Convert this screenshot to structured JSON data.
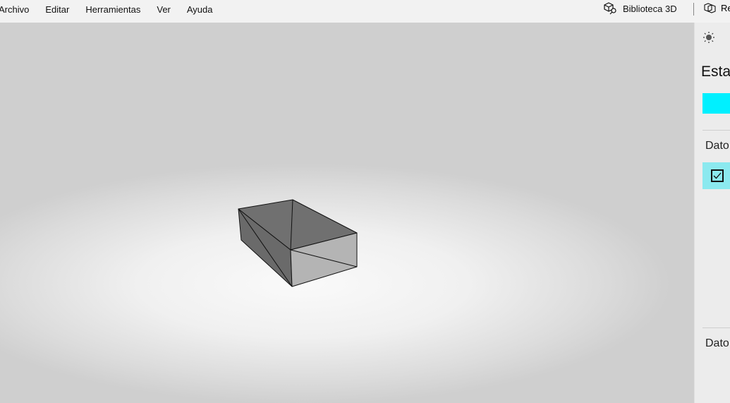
{
  "menu": {
    "items": [
      "Archivo",
      "Editar",
      "Herramientas",
      "Ver",
      "Ayuda"
    ]
  },
  "toolbar": {
    "library_label": "Biblioteca 3D",
    "re_label": "Re"
  },
  "panel": {
    "title": "Estad",
    "section1": "Dato",
    "section2": "Dato",
    "color": "#00f0ff",
    "checkbox_checked": true
  },
  "colors": {
    "accent": "#00f0ff",
    "highlight": "#8be9ef"
  }
}
